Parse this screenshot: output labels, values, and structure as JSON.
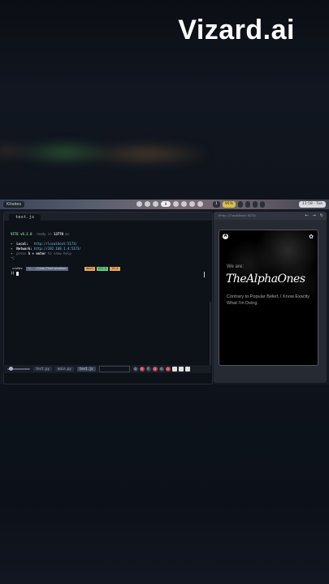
{
  "brand": {
    "text": "Vizard.ai"
  },
  "topbar": {
    "left_label": "Kitakes",
    "workspaces": [
      "",
      "",
      "",
      "8",
      "",
      "",
      "",
      ""
    ],
    "right_pills": [
      "1",
      "95%",
      "",
      "",
      "",
      ""
    ],
    "clock": "11:58 - Tue"
  },
  "terminal": {
    "tab_label": "test.js",
    "lines": {
      "vite_name": "VITE",
      "vite_version": "v6.2.0",
      "ready_text": "ready in",
      "ready_ms": "13770",
      "ms": "ms",
      "local_label": "Local:",
      "local_url": "http://localhost:5173/",
      "network_label": "Network:",
      "network_url": "http://192.168.1.4:5173/",
      "help_prefix": "press",
      "help_key": "h + enter",
      "help_suffix": "to show help",
      "tilde": "^C"
    },
    "prompt": {
      "user": "visDev",
      "path": "~/.../Code/TheAlphaOnes",
      "branch": "main",
      "node": "v23.8",
      "time": "19:4"
    },
    "cursor_prefix": "))"
  },
  "statusbar": {
    "files": [
      "test.py",
      "main.py",
      "test.js"
    ],
    "active_file": "test.js",
    "icons": [
      "o",
      "o",
      "F",
      "o",
      "o",
      "o"
    ]
  },
  "browser": {
    "url": "http://localhost:5173/",
    "controls": [
      "←",
      "→",
      "↻"
    ],
    "page": {
      "we_are": "We are:",
      "title": "TheAlphaOnes",
      "tagline": "Contrary to Popular Belief, I Know Exactly What I'm Doing."
    }
  }
}
